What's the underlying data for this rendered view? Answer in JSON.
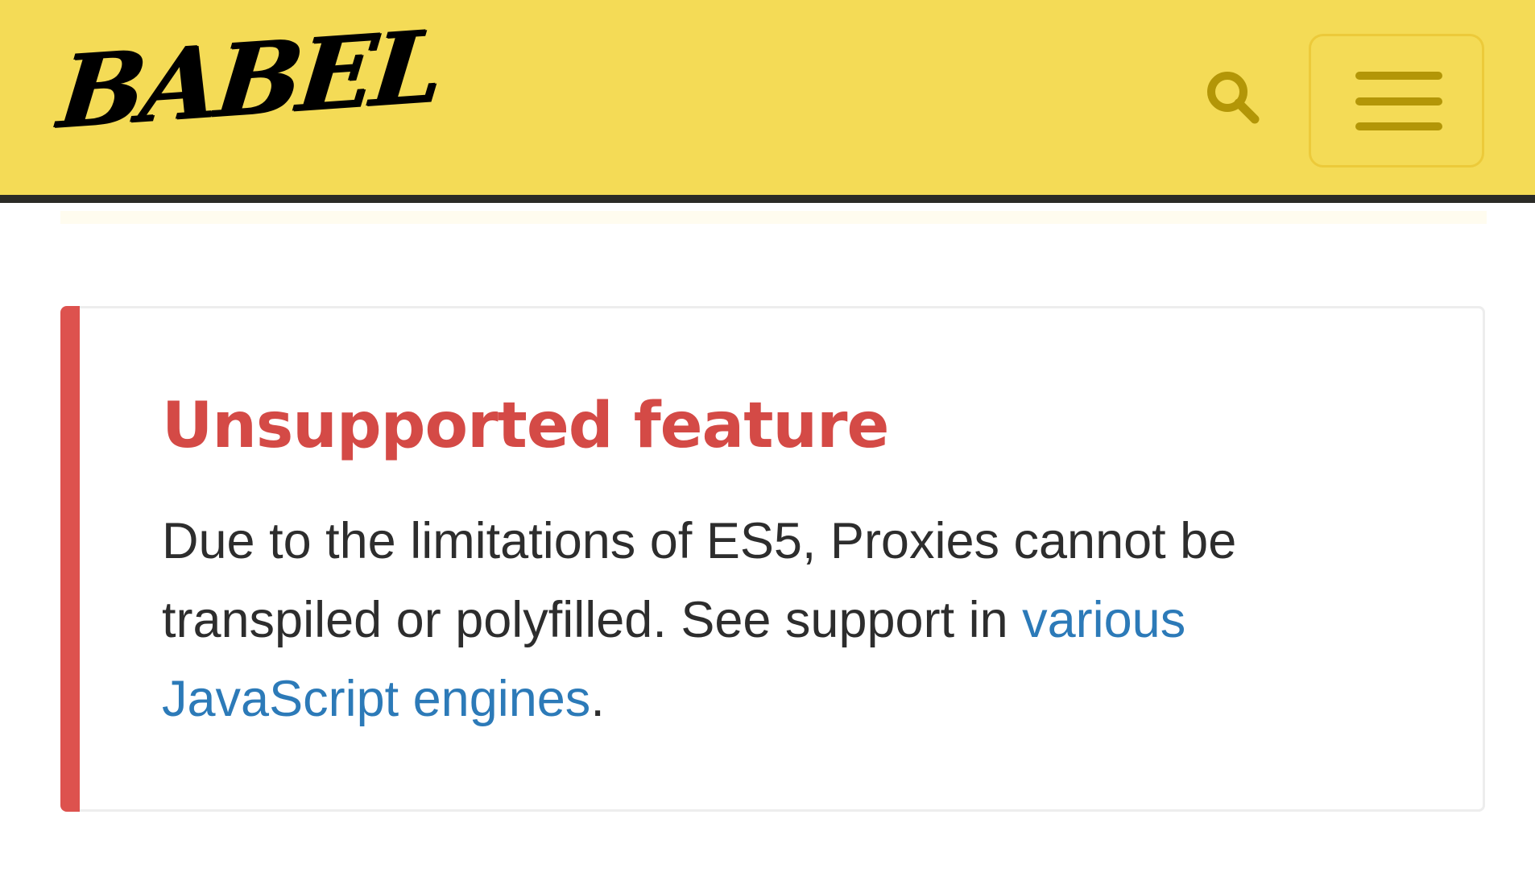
{
  "header": {
    "logo_text": "BABEL",
    "background": "#f4db56",
    "search_icon": "search-icon",
    "menu_icon": "hamburger-menu-icon"
  },
  "alert": {
    "title": "Unsupported feature",
    "accent_color": "#dd524e",
    "body_part1": "Due to the limitations of ES5, Proxies cannot be transpiled or polyfilled. See support in ",
    "link_text": "various JavaScript engines",
    "body_part2": "."
  }
}
